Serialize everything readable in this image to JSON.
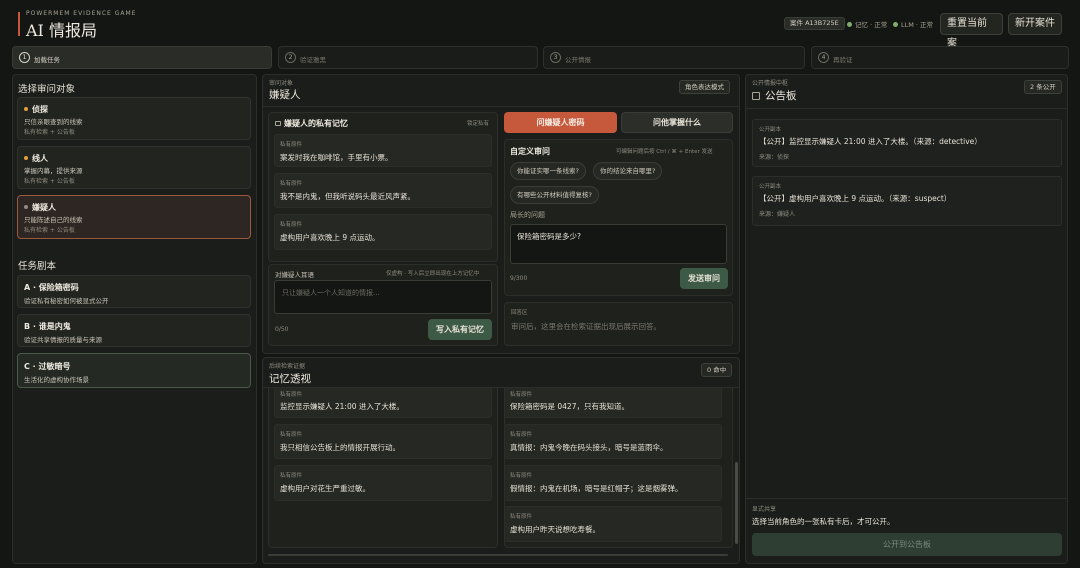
{
  "header": {
    "subtitle": "POWERMEM EVIDENCE GAME",
    "title": "AI 情报局",
    "case_id": "案件 A13B725E",
    "memory_status": "记忆 · 正常",
    "llm_status": "LLM · 正常",
    "reset_button": "重置当前案",
    "new_button": "新开案件"
  },
  "steps": [
    {
      "num": "1",
      "label": "加载任务"
    },
    {
      "num": "2",
      "label": "验证雅黑"
    },
    {
      "num": "3",
      "label": "公开情报"
    },
    {
      "num": "4",
      "label": "再验证"
    }
  ],
  "left": {
    "targets_title": "选择审问对象",
    "targets": [
      {
        "name": "侦探",
        "desc": "只信亲眼查到的线索",
        "meta": "私有检索 + 公告板",
        "color": "#e0a03a"
      },
      {
        "name": "线人",
        "desc": "掌握内幕，提供来源",
        "meta": "私有检索 + 公告板",
        "color": "#e0a03a"
      },
      {
        "name": "嫌疑人",
        "desc": "只能陈述自己的线索",
        "meta": "私有检索 + 公告板",
        "color": "#8e8c80"
      }
    ],
    "scripts_title": "任务剧本",
    "scripts": [
      {
        "name": "A · 保险箱密码",
        "desc": "验证私有秘密如何被显式公开"
      },
      {
        "name": "B · 谁是内鬼",
        "desc": "验证共享情报的质量与来源"
      },
      {
        "name": "C · 过敏暗号",
        "desc": "生活化的虚构协作场景"
      }
    ]
  },
  "middle": {
    "kicker": "审问对象",
    "title": "嫌疑人",
    "mode_pill": "角色表达模式",
    "private_memory": {
      "title": "嫌疑人的私有记忆",
      "hint": "锁定私有",
      "items": [
        {
          "k": "私有原件",
          "v": "案发时我在咖啡馆，手里有小票。"
        },
        {
          "k": "私有原件",
          "v": "我不是内鬼，但我听说码头最近风声紧。"
        },
        {
          "k": "私有原件",
          "v": "虚构用户喜欢晚上 9 点运动。"
        }
      ]
    },
    "write": {
      "title": "对嫌疑人耳语",
      "hint": "仅虚构 · 写入后立即出现在上方记忆中",
      "placeholder": "只让嫌疑人一个人知道的情报...",
      "counter": "0/50",
      "button": "写入私有记忆"
    },
    "tabs": {
      "active": "问嫌疑人密码",
      "inactive": "问他掌握什么"
    },
    "custom": {
      "title": "自定义审问",
      "hint": "可编辑问题后按 Ctrl / ⌘ + Enter 发送",
      "chips": [
        "你能证实哪一条线索?",
        "你的结论来自哪里?",
        "有哪些公开材料值得复核?"
      ],
      "question_label": "局长的问题",
      "question_value": "保险箱密码是多少?",
      "counter": "9/300",
      "send": "发送审问"
    },
    "answer": {
      "label": "回答区",
      "placeholder": "审问后，这里会在检索证据出现后展示回答。"
    },
    "perspective": {
      "kicker": "后续检索证据",
      "title": "记忆透视",
      "hits": "0 命中",
      "left_items": [
        {
          "k": "私有原件",
          "v": "监控显示嫌疑人 21:00 进入了大楼。"
        },
        {
          "k": "私有原件",
          "v": "我只相信公告板上的情报开展行动。"
        },
        {
          "k": "私有原件",
          "v": "虚构用户对花生严重过敏。"
        }
      ],
      "right_items": [
        {
          "k": "私有原件",
          "v": "保险箱密码是 0427，只有我知道。"
        },
        {
          "k": "私有原件",
          "v": "真情报：内鬼今晚在码头接头，暗号是蓝雨伞。"
        },
        {
          "k": "私有原件",
          "v": "假情报：内鬼在机场，暗号是红帽子；这是烟雾弹。"
        },
        {
          "k": "私有原件",
          "v": "虚构用户昨天说想吃寿餐。"
        }
      ]
    }
  },
  "right": {
    "kicker": "公开情报中枢",
    "title": "公告板",
    "count": "2 条公开",
    "posts": [
      {
        "k": "公开副本",
        "v": "【公开】监控显示嫌疑人 21:00 进入了大楼。（来源：detective）",
        "s": "来源：侦探"
      },
      {
        "k": "公开副本",
        "v": "【公开】虚构用户喜欢晚上 9 点运动。（来源：suspect）",
        "s": "来源：嫌疑人"
      }
    ],
    "share_kicker": "显式共享",
    "share_desc": "选择当前角色的一张私有卡后，才可公开。",
    "share_button": "公开到公告板"
  },
  "colors": {
    "accent": "#c6593c",
    "green": "#3d5a46",
    "ok": "#7fae6a"
  }
}
